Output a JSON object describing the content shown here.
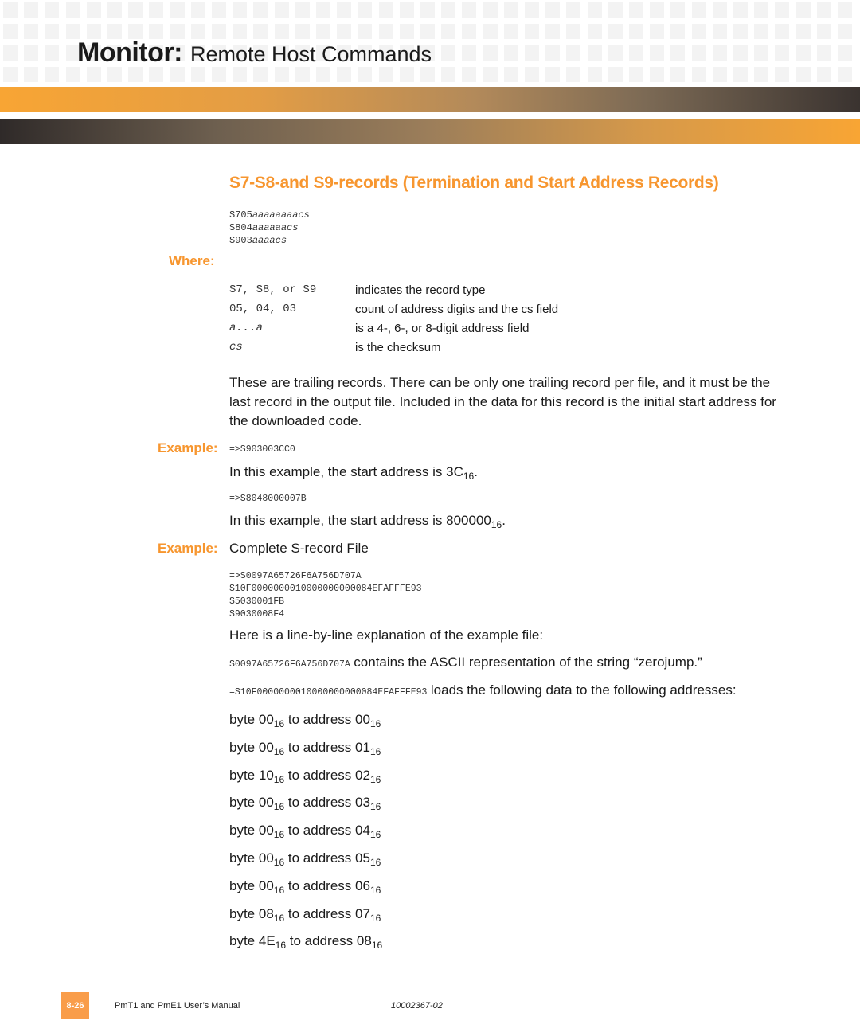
{
  "header": {
    "section": "Monitor:",
    "subtitle": "Remote Host Commands"
  },
  "colors": {
    "accent_orange": "#f7962f",
    "badge_orange": "#f99d4a",
    "dark_bar": "#2f2a29"
  },
  "section": {
    "title": "S7-S8-and S9-records (Termination and Start Address Records)",
    "syntax": [
      {
        "prefix": "S705",
        "var": "aaaaaaaacs"
      },
      {
        "prefix": "S804",
        "var": "aaaaaacs"
      },
      {
        "prefix": "S903",
        "var": "aaaacs"
      }
    ],
    "where_label": "Where:",
    "where": [
      {
        "key": "S7, S8, or S9",
        "desc": "indicates the record type"
      },
      {
        "key": "05, 04, 03",
        "desc": "count of address digits and the cs field"
      },
      {
        "key": "a...a",
        "desc": "is a 4-, 6-, or 8-digit address field"
      },
      {
        "key": "cs",
        "desc": "is the checksum"
      }
    ],
    "paragraph": "These are trailing records. There can be only one trailing record per file, and it must be the last record in the output file. Included in the data for this record is the initial start address for the downloaded code.",
    "example_label": "Example:",
    "example1": {
      "code": "=>S903003CC0",
      "text_prefix": "In this example, the start address is 3C",
      "text_sub": "16",
      "text_suffix": "."
    },
    "example2": {
      "code": "=>S8048000007B",
      "text_prefix": "In this example, the start address is 800000",
      "text_sub": "16",
      "text_suffix": "."
    },
    "example3": {
      "label": "Example:",
      "title": "Complete S-record File",
      "file_lines": [
        "=>S0097A65726F6A756D707A",
        "S10F0000000010000000000084EFAFFFE93",
        "S5030001FB",
        "S9030008F4"
      ],
      "explanation_intro": "Here is a line-by-line explanation of the example file:",
      "line1_code": "S0097A65726F6A756D707A",
      "line1_text": "contains the ASCII representation of the string “zerojump.”",
      "line2_code": "=S10F0000000010000000000084EFAFFFE93",
      "line2_text": "loads the following data to the following addresses:",
      "bytes": [
        {
          "byte": "00",
          "address": "00"
        },
        {
          "byte": "00",
          "address": "01"
        },
        {
          "byte": "10",
          "address": "02"
        },
        {
          "byte": "00",
          "address": "03"
        },
        {
          "byte": "00",
          "address": "04"
        },
        {
          "byte": "00",
          "address": "05"
        },
        {
          "byte": "00",
          "address": "06"
        },
        {
          "byte": "08",
          "address": "07"
        },
        {
          "byte": "4E",
          "address": "08"
        }
      ],
      "byte_word": "byte",
      "to_word": "to address",
      "radix": "16"
    }
  },
  "footer": {
    "page": "8-26",
    "manual": "PmT1 and PmE1 User’s Manual",
    "doc_number": "10002367-02"
  }
}
